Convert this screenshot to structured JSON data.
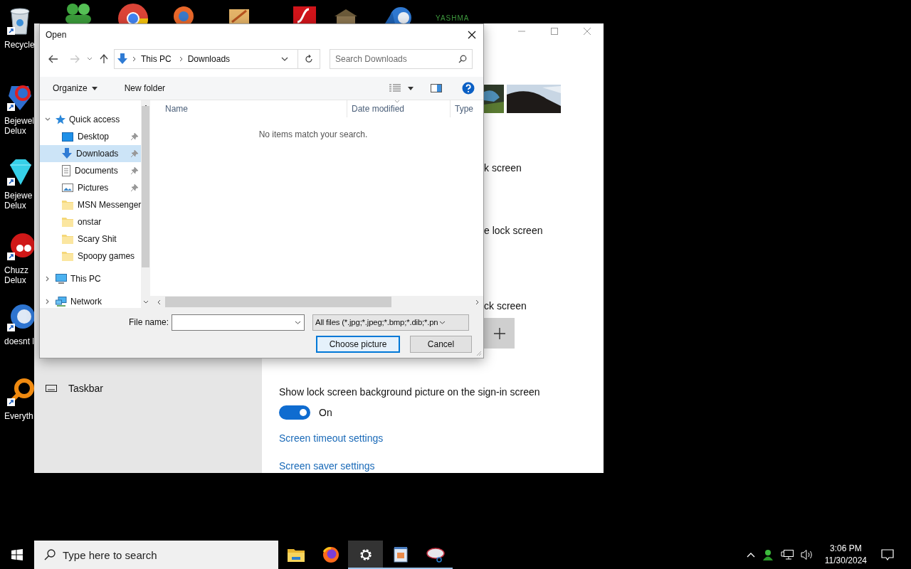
{
  "desktop": {
    "icons": [
      {
        "kind": "recycle",
        "lines": [
          "Recycle"
        ]
      },
      {
        "kind": "gem",
        "lines": [
          "Bejewel",
          "Delux"
        ]
      },
      {
        "kind": "diamond",
        "lines": [
          "Bejewe",
          "Delux"
        ]
      },
      {
        "kind": "creature",
        "lines": [
          "Chuzz",
          "Delux"
        ]
      },
      {
        "kind": "bird",
        "lines": [
          "doesnt l"
        ]
      },
      {
        "kind": "magnifier",
        "lines": [
          "Everyth"
        ]
      }
    ],
    "top_label": "YASHMA"
  },
  "settings": {
    "partial_lines": [
      "k screen",
      "e lock screen",
      "ck screen"
    ],
    "sidebar_items": [
      {
        "label": "Taskbar"
      }
    ],
    "sign_in_setting": {
      "label": "Show lock screen background picture on the sign-in screen",
      "on": true,
      "state": "On"
    },
    "links": [
      "Screen timeout settings",
      "Screen saver settings"
    ]
  },
  "dialog": {
    "title": "Open",
    "path": [
      "This PC",
      "Downloads"
    ],
    "search_placeholder": "Search Downloads",
    "toolbar": [
      "Organize",
      "New folder"
    ],
    "tree": [
      {
        "label": "Quick access",
        "kind": "star",
        "expanded": true,
        "selected": false,
        "children": [
          {
            "label": "Desktop",
            "kind": "desktop",
            "pinned": true,
            "selected": false
          },
          {
            "label": "Downloads",
            "kind": "download",
            "pinned": true,
            "selected": true
          },
          {
            "label": "Documents",
            "kind": "document",
            "pinned": true,
            "selected": false
          },
          {
            "label": "Pictures",
            "kind": "pictures",
            "pinned": true,
            "selected": false
          },
          {
            "label": "MSN Messenger",
            "kind": "folder",
            "pinned": false,
            "selected": false
          },
          {
            "label": "onstar",
            "kind": "folder",
            "pinned": false,
            "selected": false
          },
          {
            "label": "Scary Shit",
            "kind": "folder",
            "pinned": false,
            "selected": false
          },
          {
            "label": "Spoopy games",
            "kind": "folder",
            "pinned": false,
            "selected": false
          }
        ]
      },
      {
        "label": "This PC",
        "kind": "pc",
        "expanded": false,
        "selected": false
      },
      {
        "label": "Network",
        "kind": "network",
        "expanded": false,
        "selected": false
      }
    ],
    "columns": [
      "Name",
      "Date modified",
      "Type"
    ],
    "empty_message": "No items match your search.",
    "file_name_label": "File name:",
    "file_type": "All files (*.jpg;*.jpeg;*.bmp;*.dib;*.pn",
    "buttons": [
      {
        "label": "Choose picture",
        "default": true
      },
      {
        "label": "Cancel",
        "default": false
      }
    ]
  },
  "taskbar": {
    "search_placeholder": "Type here to search",
    "apps": [
      {
        "kind": "folder",
        "running": false,
        "selected": false
      },
      {
        "kind": "browser",
        "running": false,
        "selected": false
      },
      {
        "kind": "settings",
        "running": true,
        "selected": true
      },
      {
        "kind": "notepad",
        "running": true,
        "selected": false
      },
      {
        "kind": "snip",
        "running": true,
        "selected": false
      }
    ],
    "clock": {
      "time": "3:06 PM",
      "date": "11/30/2024"
    }
  }
}
